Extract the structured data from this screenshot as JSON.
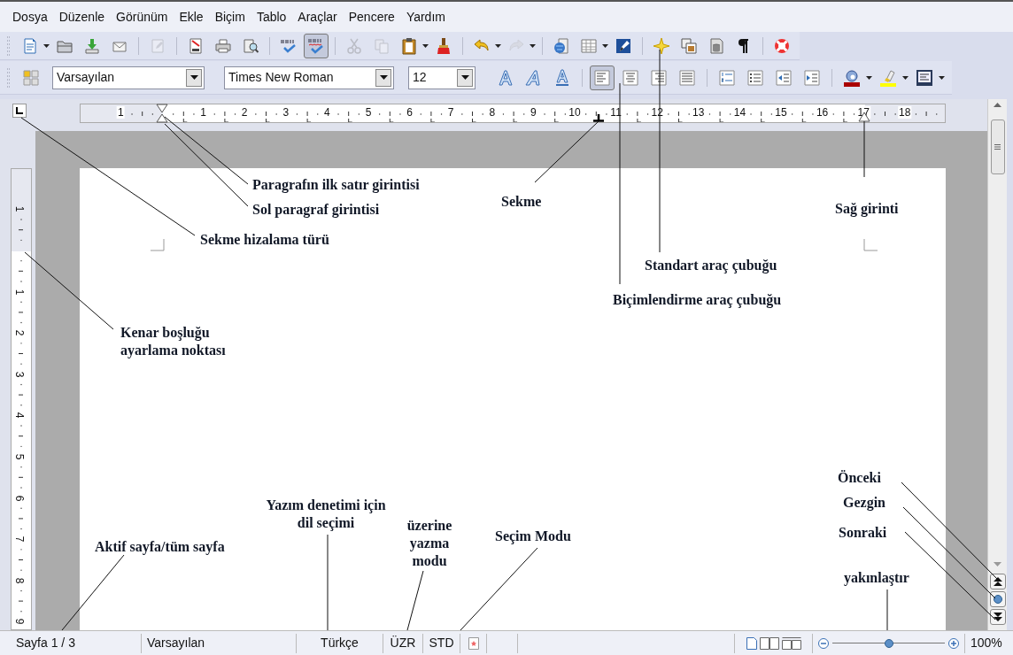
{
  "menu": [
    "Dosya",
    "Düzenle",
    "Görünüm",
    "Ekle",
    "Biçim",
    "Tablo",
    "Araçlar",
    "Pencere",
    "Yardım"
  ],
  "standard_toolbar": [
    {
      "kind": "new",
      "disabled": false,
      "pressed": false
    },
    {
      "kind": "caret"
    },
    {
      "kind": "open",
      "disabled": false,
      "pressed": false
    },
    {
      "kind": "save",
      "disabled": false,
      "pressed": false
    },
    {
      "kind": "mail",
      "disabled": false,
      "pressed": false
    },
    {
      "kind": "separator"
    },
    {
      "kind": "edit",
      "disabled": true,
      "pressed": false
    },
    {
      "kind": "separator"
    },
    {
      "kind": "pdf",
      "disabled": false,
      "pressed": false
    },
    {
      "kind": "print",
      "disabled": false,
      "pressed": false
    },
    {
      "kind": "preview",
      "disabled": false,
      "pressed": false
    },
    {
      "kind": "separator"
    },
    {
      "kind": "spell",
      "disabled": false
    },
    {
      "kind": "autospell",
      "disabled": false,
      "pressed": true
    },
    {
      "kind": "separator"
    },
    {
      "kind": "cut",
      "disabled": true,
      "pressed": false
    },
    {
      "kind": "copy",
      "disabled": true,
      "pressed": false
    },
    {
      "kind": "paste",
      "disabled": false,
      "pressed": false
    },
    {
      "kind": "caret"
    },
    {
      "kind": "brush",
      "disabled": false,
      "pressed": false
    },
    {
      "kind": "separator"
    },
    {
      "kind": "undo",
      "disabled": false,
      "pressed": false
    },
    {
      "kind": "caret"
    },
    {
      "kind": "redo",
      "disabled": true,
      "pressed": false
    },
    {
      "kind": "caret"
    },
    {
      "kind": "separator"
    },
    {
      "kind": "globe",
      "disabled": false,
      "pressed": false
    },
    {
      "kind": "table",
      "disabled": false,
      "pressed": false
    },
    {
      "kind": "caret"
    },
    {
      "kind": "draw",
      "disabled": false,
      "pressed": false
    },
    {
      "kind": "separator"
    },
    {
      "kind": "navigator",
      "disabled": false,
      "pressed": false
    },
    {
      "kind": "gallery",
      "disabled": false,
      "pressed": false
    },
    {
      "kind": "datasource",
      "disabled": false,
      "pressed": false
    },
    {
      "kind": "pilcrow",
      "disabled": false,
      "pressed": false
    },
    {
      "kind": "separator"
    },
    {
      "kind": "help",
      "disabled": false,
      "pressed": false
    }
  ],
  "formatting_toolbar": {
    "style": "Varsayılan",
    "font": "Times New Roman",
    "size": "12",
    "buttons": [
      {
        "kind": "styles",
        "disabled": false,
        "pressed": false
      },
      {
        "kind": "outline",
        "disabled": false,
        "pressed": false
      },
      {
        "kind": "italic",
        "disabled": false,
        "pressed": false
      },
      {
        "kind": "underline",
        "disabled": false,
        "pressed": false
      },
      {
        "kind": "separator"
      },
      {
        "kind": "alignleft",
        "disabled": false,
        "pressed": true
      },
      {
        "kind": "aligncenter",
        "disabled": false,
        "pressed": false
      },
      {
        "kind": "alignright",
        "disabled": false,
        "pressed": false
      },
      {
        "kind": "justify",
        "disabled": false,
        "pressed": false
      },
      {
        "kind": "separator"
      },
      {
        "kind": "numbered",
        "disabled": false,
        "pressed": false
      },
      {
        "kind": "bullets",
        "disabled": false,
        "pressed": false
      },
      {
        "kind": "outdent",
        "disabled": false,
        "pressed": false
      },
      {
        "kind": "indent",
        "disabled": false,
        "pressed": false
      },
      {
        "kind": "separator"
      },
      {
        "kind": "fontcolor",
        "disabled": false,
        "pressed": false
      },
      {
        "kind": "caret"
      },
      {
        "kind": "highlight",
        "disabled": false,
        "pressed": false
      },
      {
        "kind": "caret"
      },
      {
        "kind": "bgcolor",
        "disabled": false,
        "pressed": false
      },
      {
        "kind": "caret"
      }
    ]
  },
  "ruler": {
    "numbers": [
      "1",
      "1",
      "2",
      "3",
      "4",
      "5",
      "6",
      "7",
      "8",
      "9",
      "10",
      "11",
      "12",
      "13",
      "14",
      "15",
      "16",
      "17",
      "18"
    ]
  },
  "vertical_ruler": {
    "numbers": [
      "1",
      "1",
      "2",
      "3",
      "4",
      "5",
      "6",
      "7",
      "8",
      "9"
    ]
  },
  "status_bar": {
    "page": "Sayfa 1 / 3",
    "style": "Varsayılan",
    "language": "Türkçe",
    "insert_mode": "ÜZR",
    "selection_mode": "STD",
    "zoom": {
      "level": 0.5,
      "reading": "100%"
    }
  },
  "annotations": [
    {
      "text": "Paragrafın ilk satır girintisi"
    },
    {
      "text": "Sol paragraf girintisi"
    },
    {
      "text": "Sekme hizalama türü"
    },
    {
      "text": "Sekme"
    },
    {
      "text": "Sağ girinti"
    },
    {
      "text": "Standart araç çubuğu"
    },
    {
      "text": "Biçimlendirme araç çubuğu"
    },
    {
      "text": "Kenar boşluğu ayarlama noktası"
    },
    {
      "text": "Aktif sayfa/tüm sayfa"
    },
    {
      "text": "Yazım denetimi için dil seçimi"
    },
    {
      "text": "üzerine yazma modu"
    },
    {
      "text": "Seçim Modu"
    },
    {
      "text": "Önceki"
    },
    {
      "text": "Gezgin"
    },
    {
      "text": "Sonraki"
    },
    {
      "text": "yakınlaştır"
    }
  ]
}
